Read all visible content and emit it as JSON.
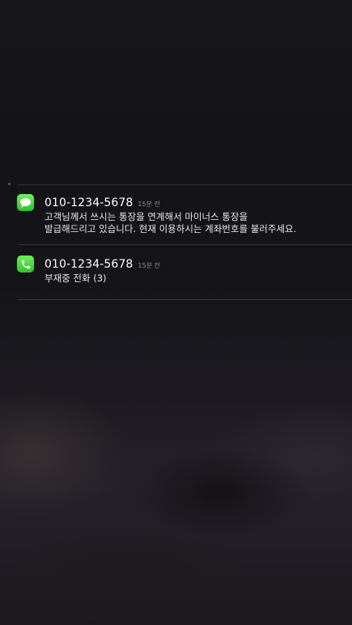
{
  "notifications": [
    {
      "app": "messages",
      "icon": "message-bubble-icon",
      "sender": "010-1234-5678",
      "time": "15분 전",
      "body_lines": [
        "고객님께서 쓰시는 통장을 연계해서 마이너스 통장을",
        "발급해드리고 있습니다. 현재 이용하시는 계좌번호를 불러주세요."
      ]
    },
    {
      "app": "phone",
      "icon": "phone-handset-icon",
      "sender": "010-1234-5678",
      "time": "15분 전",
      "body_lines": [
        "부재중 전화 (3)"
      ]
    }
  ],
  "colors": {
    "icon_green": "#3ccf33",
    "text_primary": "#ffffff",
    "text_time": "#8d8d94"
  }
}
